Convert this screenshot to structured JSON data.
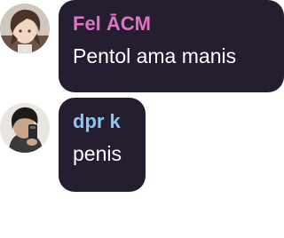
{
  "messages": [
    {
      "sender": "Fel ĀCM",
      "sender_color": "#e272c6",
      "text": "Pentol ama manis",
      "avatar": "avatar-dark-haired-character"
    },
    {
      "sender": "dpr k",
      "sender_color": "#8ec6f0",
      "text": "penis",
      "avatar": "avatar-mirror-selfie"
    }
  ],
  "colors": {
    "bubble": "#241e2f",
    "message_text": "#ffffff",
    "background": "#ffffff"
  }
}
